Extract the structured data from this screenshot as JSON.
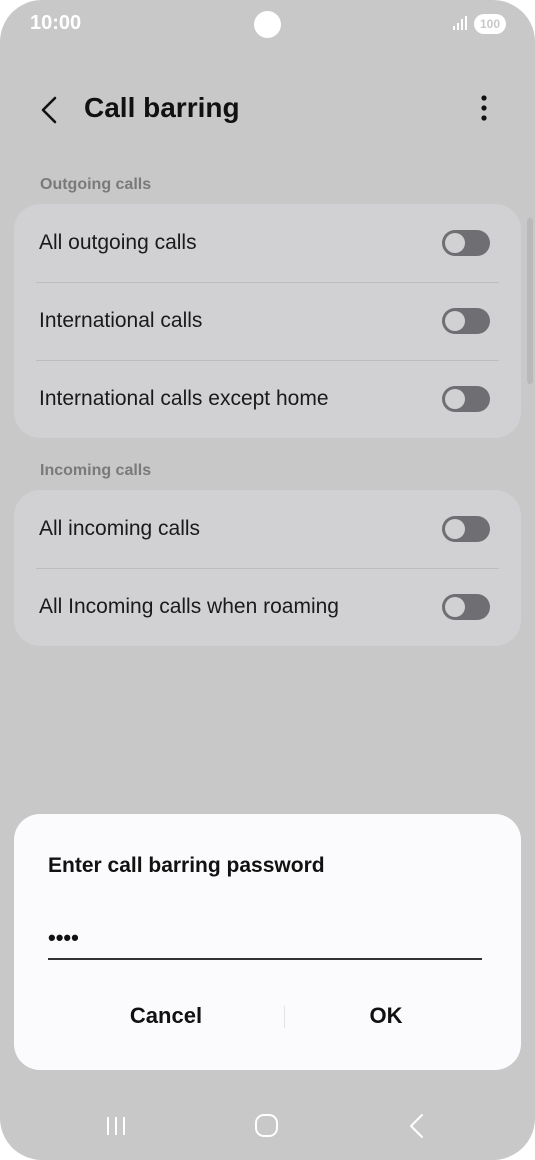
{
  "status_bar": {
    "time": "10:00",
    "battery": "100"
  },
  "header": {
    "title": "Call barring"
  },
  "sections": [
    {
      "label": "Outgoing calls",
      "items": [
        {
          "label": "All outgoing calls",
          "enabled": false
        },
        {
          "label": "International calls",
          "enabled": false
        },
        {
          "label": "International calls except home",
          "enabled": false
        }
      ]
    },
    {
      "label": "Incoming calls",
      "items": [
        {
          "label": "All incoming calls",
          "enabled": false
        },
        {
          "label": "All Incoming calls when roaming",
          "enabled": false
        }
      ]
    }
  ],
  "dialog": {
    "title": "Enter call barring password",
    "password_value": "••••",
    "cancel_label": "Cancel",
    "ok_label": "OK"
  },
  "nav": {
    "recents": "recents-icon",
    "home": "home-icon",
    "back": "back-icon"
  }
}
